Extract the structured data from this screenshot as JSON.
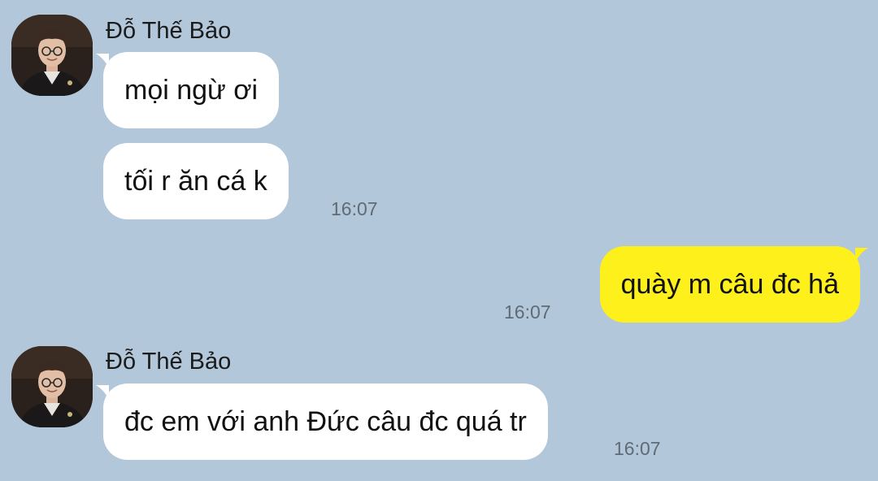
{
  "colors": {
    "background": "#b2c7d9",
    "incoming_bubble": "#ffffff",
    "outgoing_bubble": "#fef01b",
    "timestamp": "#5f6b76"
  },
  "messages": [
    {
      "direction": "incoming",
      "sender": "Đỗ Thế Bảo",
      "avatar_icon": "profile-photo",
      "bubbles": [
        "mọi ngừ ơi",
        "tối r ăn cá k"
      ],
      "time": "16:07"
    },
    {
      "direction": "outgoing",
      "bubbles": [
        "quày m câu đc hả"
      ],
      "time": "16:07"
    },
    {
      "direction": "incoming",
      "sender": "Đỗ Thế Bảo",
      "avatar_icon": "profile-photo",
      "bubbles": [
        "đc em với anh Đức câu đc quá tr"
      ],
      "time": "16:07"
    }
  ]
}
